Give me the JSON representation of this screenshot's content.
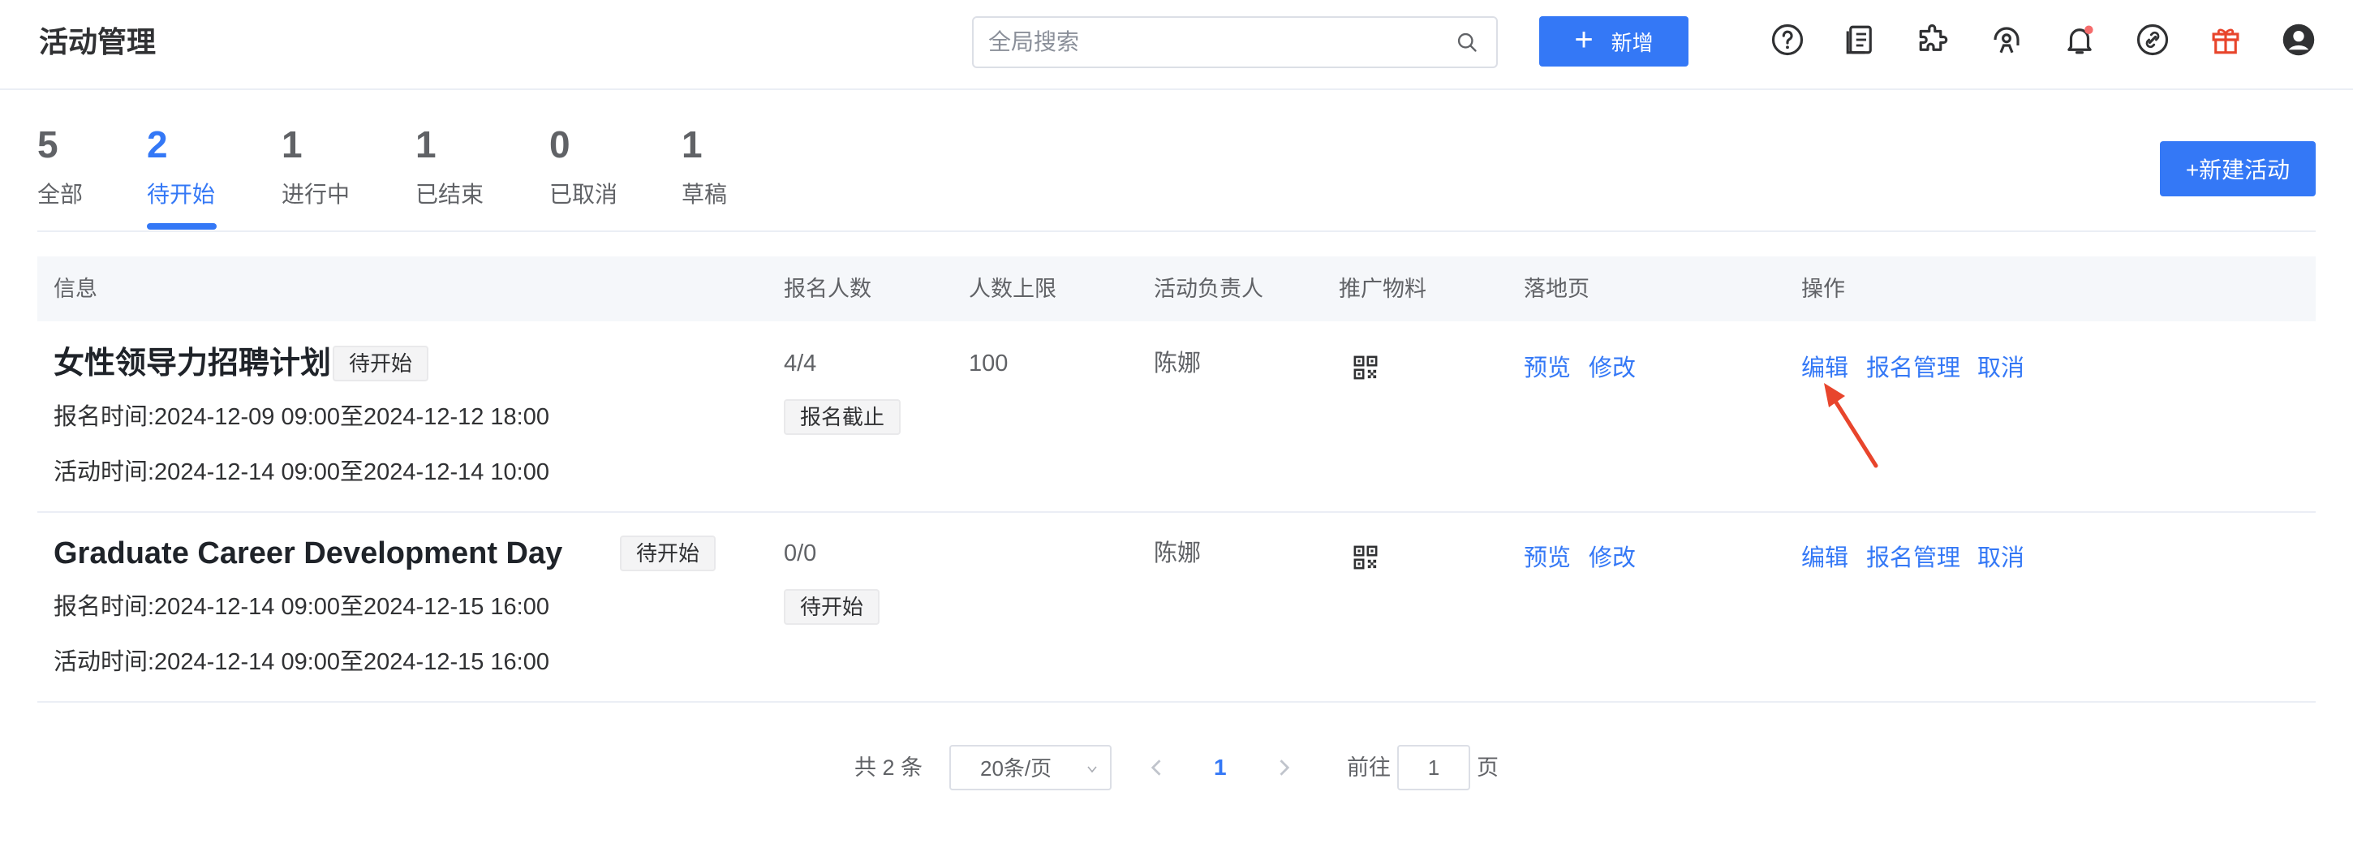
{
  "header": {
    "title": "活动管理",
    "search_placeholder": "全局搜索",
    "add_label": "新增",
    "icons": [
      "help-icon",
      "document-icon",
      "plugin-icon",
      "support-icon",
      "notification-bell-icon",
      "link-icon",
      "gift-icon",
      "user-avatar-icon"
    ],
    "notification_dot_color": "#f56c6c"
  },
  "tabs": [
    {
      "count": "5",
      "label": "全部"
    },
    {
      "count": "2",
      "label": "待开始"
    },
    {
      "count": "1",
      "label": "进行中"
    },
    {
      "count": "1",
      "label": "已结束"
    },
    {
      "count": "0",
      "label": "已取消"
    },
    {
      "count": "1",
      "label": "草稿"
    }
  ],
  "active_tab": "待开始",
  "new_activity_label": "+新建活动",
  "table": {
    "columns": [
      "信息",
      "报名人数",
      "人数上限",
      "活动负责人",
      "推广物料",
      "落地页",
      "操作"
    ],
    "rows": [
      {
        "title": "女性领导力招聘计划",
        "status_tag": "待开始",
        "signup_time": "报名时间:2024-12-09 09:00至2024-12-12 18:00",
        "activity_time": "活动时间:2024-12-14 09:00至2024-12-14 10:00",
        "signups": "4/4",
        "signup_status": "报名截止",
        "limit": "100",
        "owner": "陈娜",
        "landing_links": [
          "预览",
          "修改"
        ],
        "actions": [
          "编辑",
          "报名管理",
          "取消"
        ]
      },
      {
        "title": "Graduate Career Development Day",
        "status_tag": "待开始",
        "signup_time": "报名时间:2024-12-14 09:00至2024-12-15 16:00",
        "activity_time": "活动时间:2024-12-14 09:00至2024-12-15 16:00",
        "signups": "0/0",
        "signup_status": "待开始",
        "limit": "",
        "owner": "陈娜",
        "landing_links": [
          "预览",
          "修改"
        ],
        "actions": [
          "编辑",
          "报名管理",
          "取消"
        ]
      }
    ]
  },
  "pagination": {
    "total": "共 2 条",
    "page_size": "20条/页",
    "current_page": "1",
    "goto_label": "前往",
    "goto_value": "1",
    "page_suffix": "页"
  },
  "colors": {
    "accent": "#3478f6",
    "annotation_arrow": "#e8452c"
  }
}
